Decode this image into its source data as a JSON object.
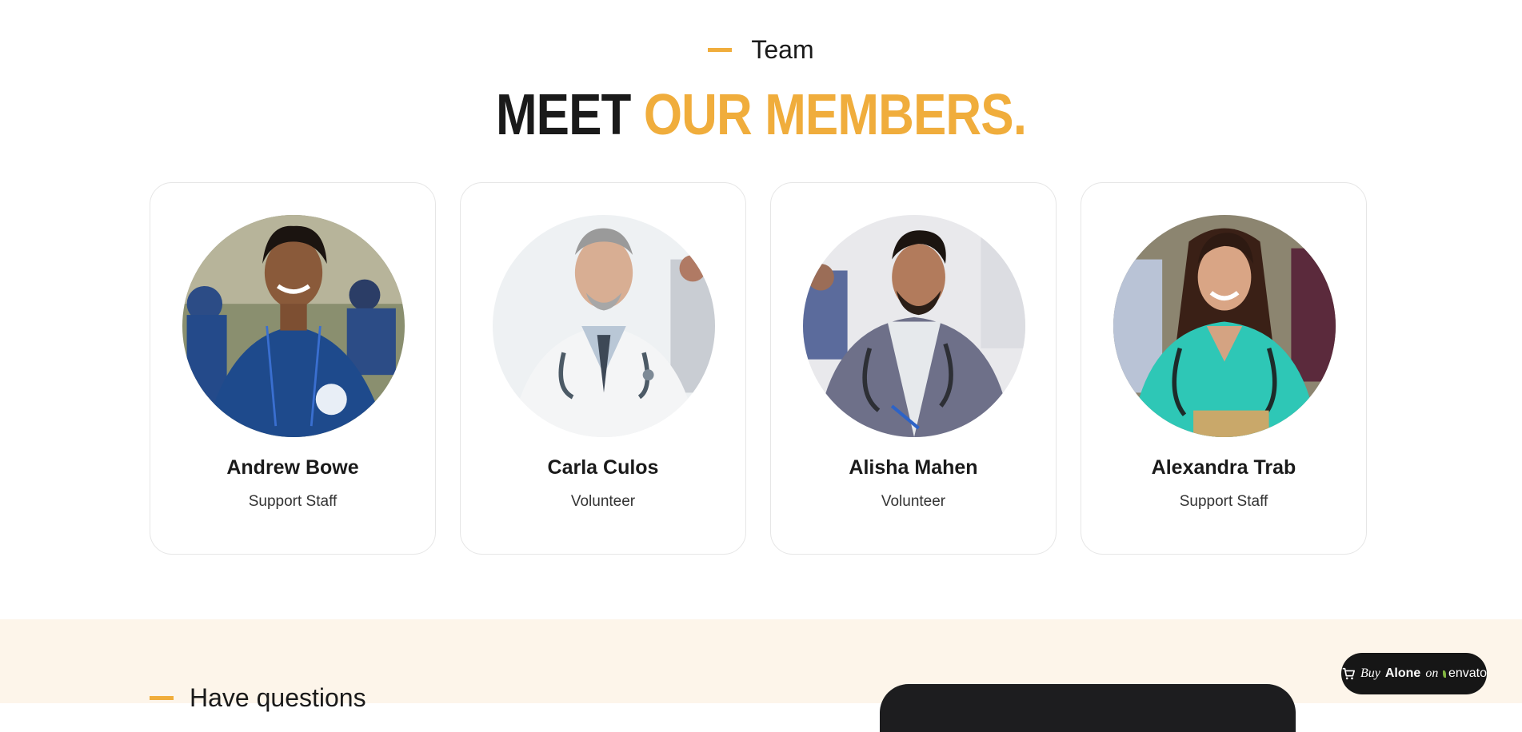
{
  "team": {
    "eyebrow": "Team",
    "heading_dark": "MEET ",
    "heading_accent": "OUR MEMBERS.",
    "members": [
      {
        "name": "Andrew Bowe",
        "role": "Support Staff"
      },
      {
        "name": "Carla Culos",
        "role": "Volunteer"
      },
      {
        "name": "Alisha Mahen",
        "role": "Volunteer"
      },
      {
        "name": "Alexandra Trab",
        "role": "Support Staff"
      }
    ]
  },
  "faq": {
    "eyebrow": "Have questions"
  },
  "buy_button": {
    "buy": "Buy",
    "product": "Alone",
    "on": "on",
    "marketplace": "envato"
  },
  "colors": {
    "accent": "#f0ad3c",
    "dark": "#1a1a1a",
    "faq_background": "#fdf5ea"
  },
  "icons": {
    "cart": "cart-icon",
    "envato_leaf": "envato-leaf-icon"
  }
}
